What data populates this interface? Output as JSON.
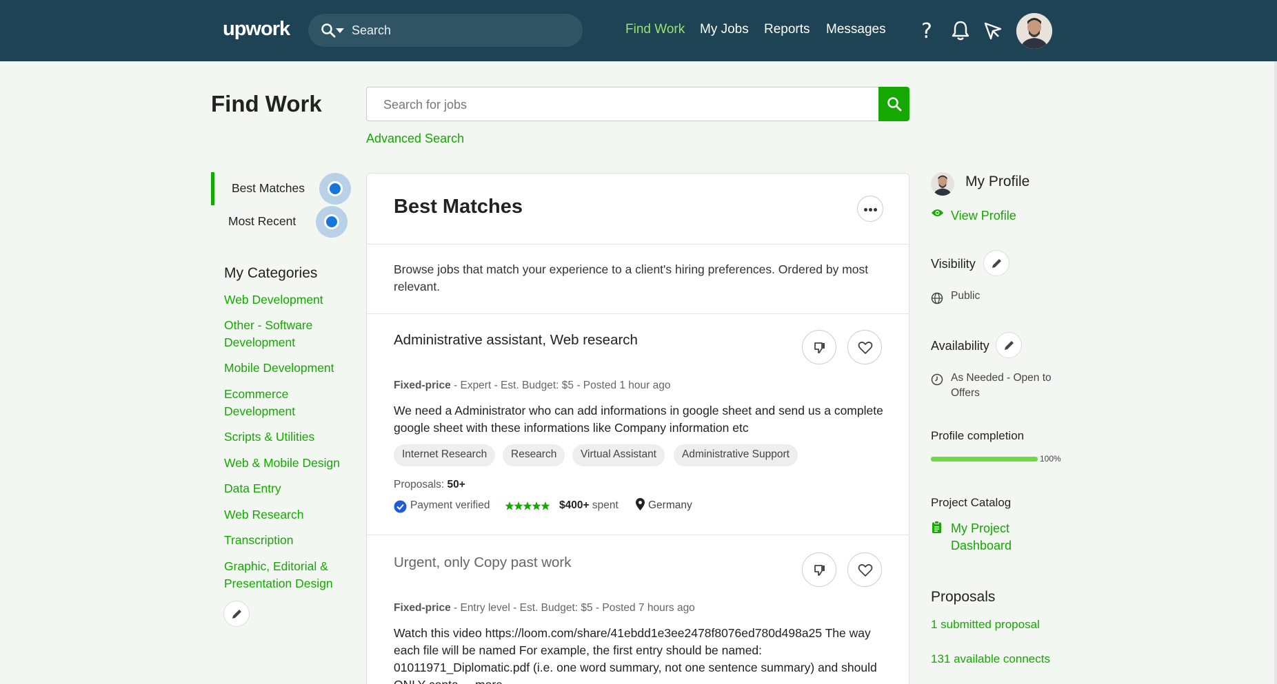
{
  "header": {
    "logo": "upwork",
    "search_placeholder": "Search",
    "nav": [
      "Find Work",
      "My Jobs",
      "Reports",
      "Messages"
    ]
  },
  "page": {
    "title": "Find Work",
    "search_placeholder": "Search for jobs",
    "advanced_search": "Advanced Search"
  },
  "sidebar": {
    "tabs": [
      "Best Matches",
      "Most Recent"
    ],
    "categories_title": "My Categories",
    "categories": [
      "Web Development",
      "Other - Software Development",
      "Mobile Development",
      "Ecommerce Development",
      "Scripts & Utilities",
      "Web & Mobile Design",
      "Data Entry",
      "Web Research",
      "Transcription",
      "Graphic, Editorial & Presentation Design"
    ]
  },
  "feed": {
    "title": "Best Matches",
    "description": "Browse jobs that match your experience to a client's hiring preferences. Ordered by most relevant.",
    "jobs": [
      {
        "title": "Administrative assistant, Web research",
        "type": "Fixed-price",
        "meta": " - Expert - Est. Budget: $5 - Posted 1 hour ago",
        "description": "We need a Administrator who can add informations in google sheet and send us a complete google sheet with these informations like Company information etc",
        "tags": [
          "Internet Research",
          "Research",
          "Virtual Assistant",
          "Administrative Support"
        ],
        "proposals_label": "Proposals: ",
        "proposals": "50+",
        "payment": "Payment verified",
        "rating": 5,
        "spent_amount": "$400+",
        "spent_label": " spent",
        "country": "Germany"
      },
      {
        "title": "Urgent, only Copy past work",
        "type": "Fixed-price",
        "meta": " - Entry level - Est. Budget: $5 - Posted 7 hours ago",
        "description": "Watch this video https://loom.com/share/41ebdd1e3ee2478f8076ed780d498a25 The way each file will be named For example, the first entry should be named: 01011971_Diplomatic.pdf (i.e. one word summary, not one sentence summary) and should ONLY conta ... more"
      }
    ]
  },
  "profile": {
    "title": "My Profile",
    "view_profile": "View Profile",
    "visibility_label": "Visibility",
    "visibility_value": "Public",
    "availability_label": "Availability",
    "availability_value": "As Needed - Open to Offers",
    "completion_label": "Profile completion",
    "completion_pct": "100%",
    "completion_value": 1.0,
    "catalog_label": "Project Catalog",
    "catalog_link": "My Project Dashboard",
    "proposals_title": "Proposals",
    "submitted": "1 submitted proposal",
    "connects": "131 available connects"
  },
  "colors": {
    "brand_green": "#14a800",
    "header_bg": "#1d4354",
    "nav_active": "#9ae46a",
    "radio_blue": "#1777d8"
  }
}
